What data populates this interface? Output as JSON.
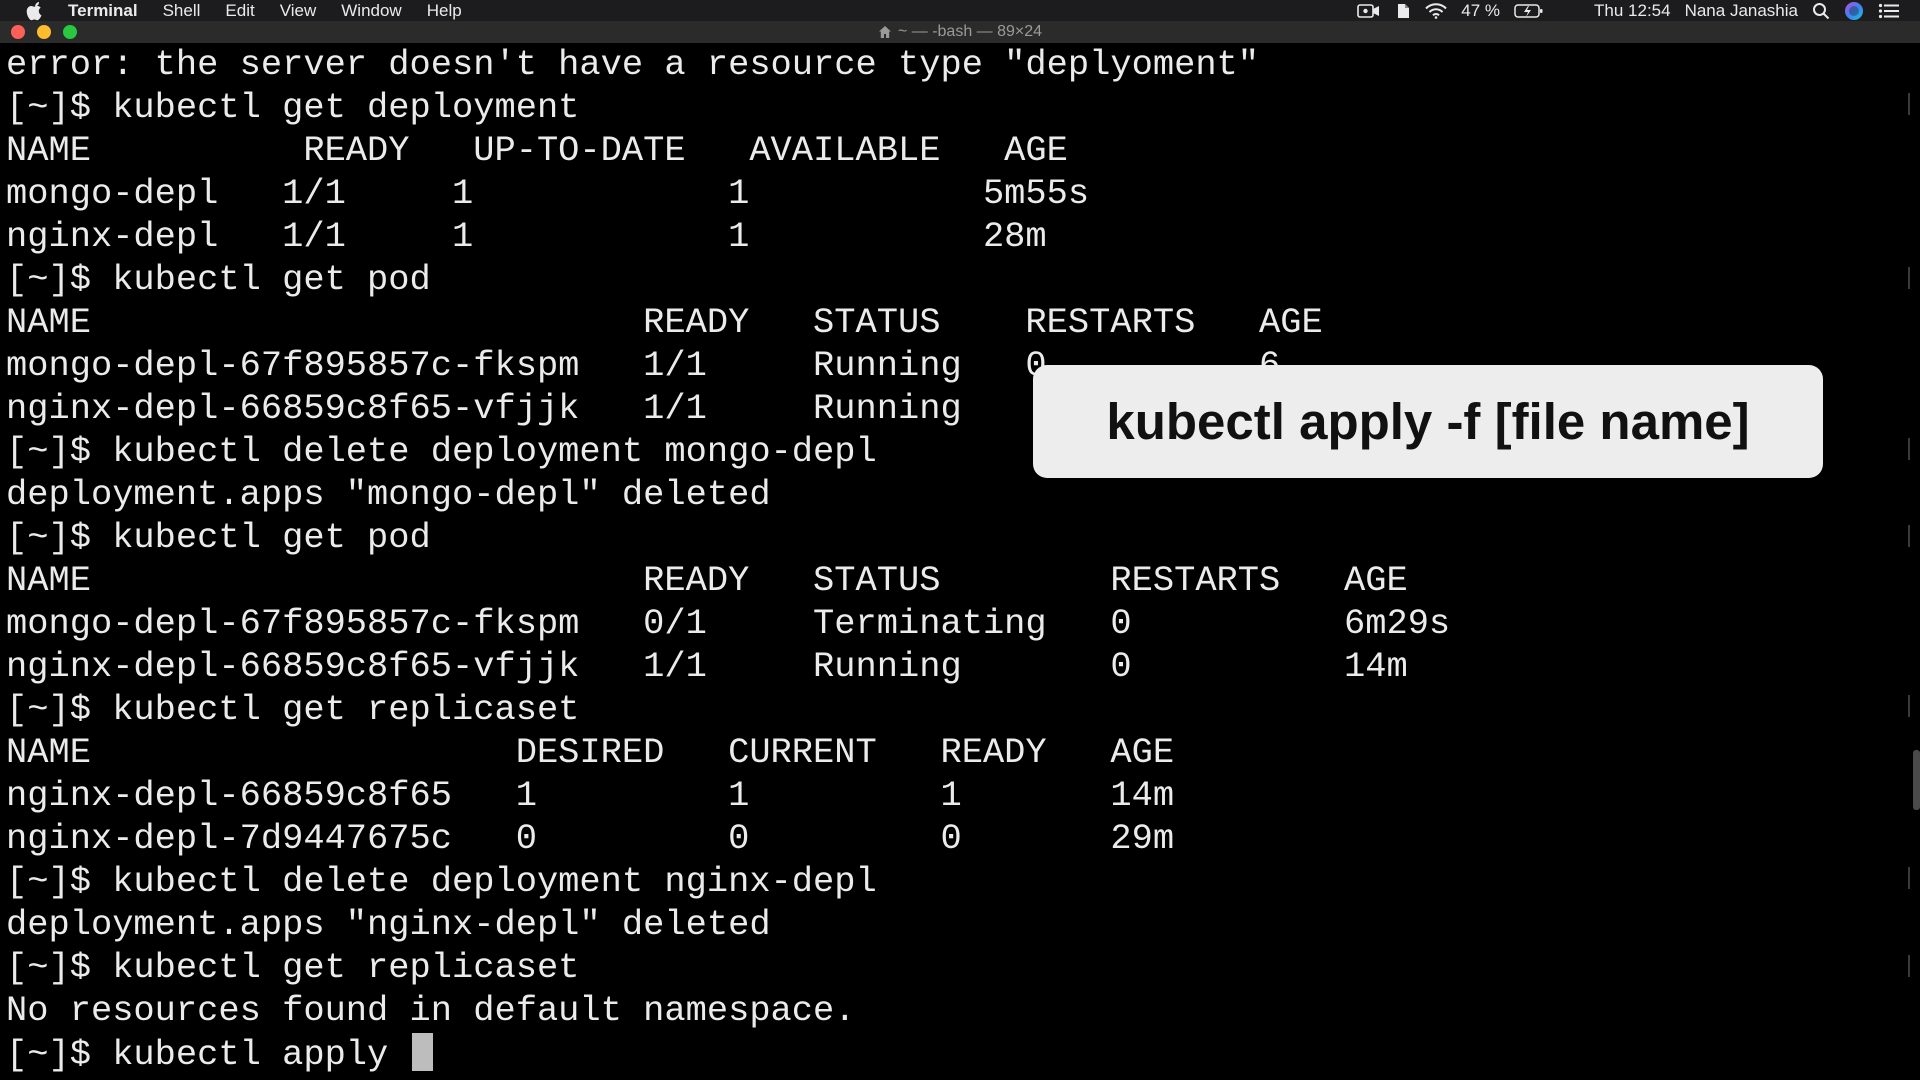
{
  "menubar": {
    "app_name": "Terminal",
    "items": [
      "Shell",
      "Edit",
      "View",
      "Window",
      "Help"
    ],
    "battery": "47 %",
    "clock": "Thu 12:54",
    "user": "Nana Janashia",
    "icons": [
      "apple-icon",
      "screen-record-icon",
      "evernote-icon",
      "wifi-icon",
      "battery-charging-icon",
      "flag-icon",
      "spotlight-search-icon",
      "siri-icon",
      "notification-center-icon"
    ]
  },
  "window": {
    "title": "~ — -bash — 89×24"
  },
  "terminal": {
    "lines": [
      "error: the server doesn't have a resource type \"deplyoment\"",
      "[~]$ kubectl get deployment",
      "NAME          READY   UP-TO-DATE   AVAILABLE   AGE",
      "mongo-depl   1/1     1            1           5m55s",
      "nginx-depl   1/1     1            1           28m",
      "[~]$ kubectl get pod",
      "NAME                          READY   STATUS    RESTARTS   AGE",
      "mongo-depl-67f895857c-fkspm   1/1     Running   0          6",
      "nginx-depl-66859c8f65-vfjjk   1/1     Running",
      "[~]$ kubectl delete deployment mongo-depl",
      "deployment.apps \"mongo-depl\" deleted",
      "[~]$ kubectl get pod",
      "NAME                          READY   STATUS        RESTARTS   AGE",
      "mongo-depl-67f895857c-fkspm   0/1     Terminating   0          6m29s",
      "nginx-depl-66859c8f65-vfjjk   1/1     Running       0          14m",
      "[~]$ kubectl get replicaset",
      "NAME                    DESIRED   CURRENT   READY   AGE",
      "nginx-depl-66859c8f65   1         1         1       14m",
      "nginx-depl-7d9447675c   0         0         0       29m",
      "[~]$ kubectl delete deployment nginx-depl",
      "deployment.apps \"nginx-depl\" deleted",
      "[~]$ kubectl get replicaset",
      "No resources found in default namespace."
    ],
    "prompt_line": "[~]$ kubectl apply "
  },
  "overlay": {
    "caption": "kubectl apply -f [file name]"
  },
  "colors": {
    "background": "#000000",
    "text": "#ebebeb",
    "overlay_bg": "#ededed",
    "close": "#fe5f57",
    "minimize": "#febc2e",
    "maximize": "#28c840"
  }
}
